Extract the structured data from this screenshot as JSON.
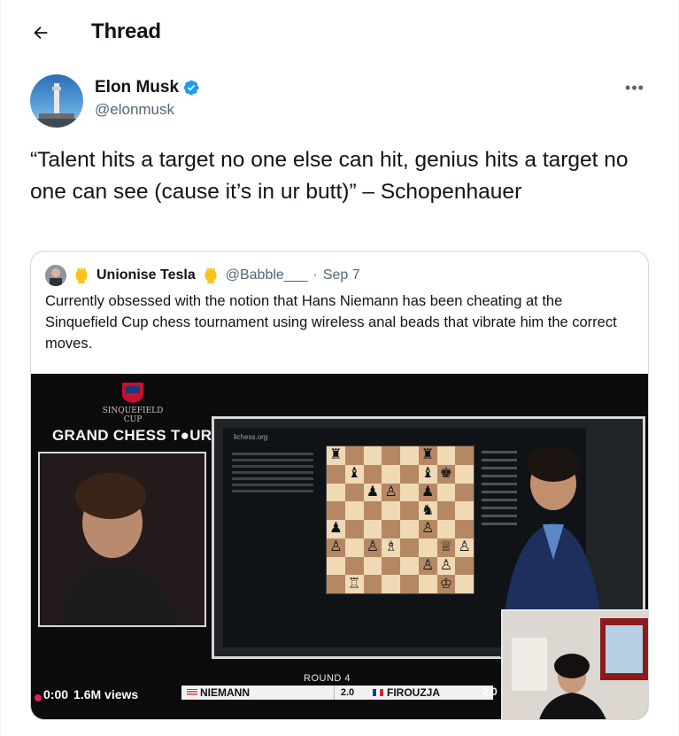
{
  "header": {
    "title": "Thread"
  },
  "author": {
    "name": "Elon Musk",
    "handle": "@elonmusk",
    "verified": true
  },
  "tweet": {
    "text": "“Talent hits a target no one else can hit, genius hits a target no one can see (cause it’s in ur butt)” – Schopenhauer"
  },
  "quote": {
    "name": "Unionise Tesla",
    "handle": "@Babble___",
    "separator": "·",
    "date": "Sep 7",
    "text": "Currently obsessed with the notion that Hans Niemann has been cheating at the Sinquefield Cup chess tournament using wireless anal beads that vibrate him the correct moves.",
    "video": {
      "logo_text": "SINQUEFIELD CUP",
      "tour_title": "GRAND CHESS T●UR",
      "site_label": "lichess.org",
      "round_label": "ROUND 4",
      "player_left": "NIEMANN",
      "score_left": "2.0",
      "player_right": "FIROUZJA",
      "score_right": "2.0",
      "time": "0:00",
      "views": "1.6M views"
    }
  },
  "colors": {
    "verified_blue": "#1d9bf0",
    "secondary_text": "#536471",
    "border": "#cfd9de"
  },
  "icons": {
    "back": "arrow-left-icon",
    "verified": "verified-badge-icon",
    "more": "more-horizontal-icon"
  }
}
